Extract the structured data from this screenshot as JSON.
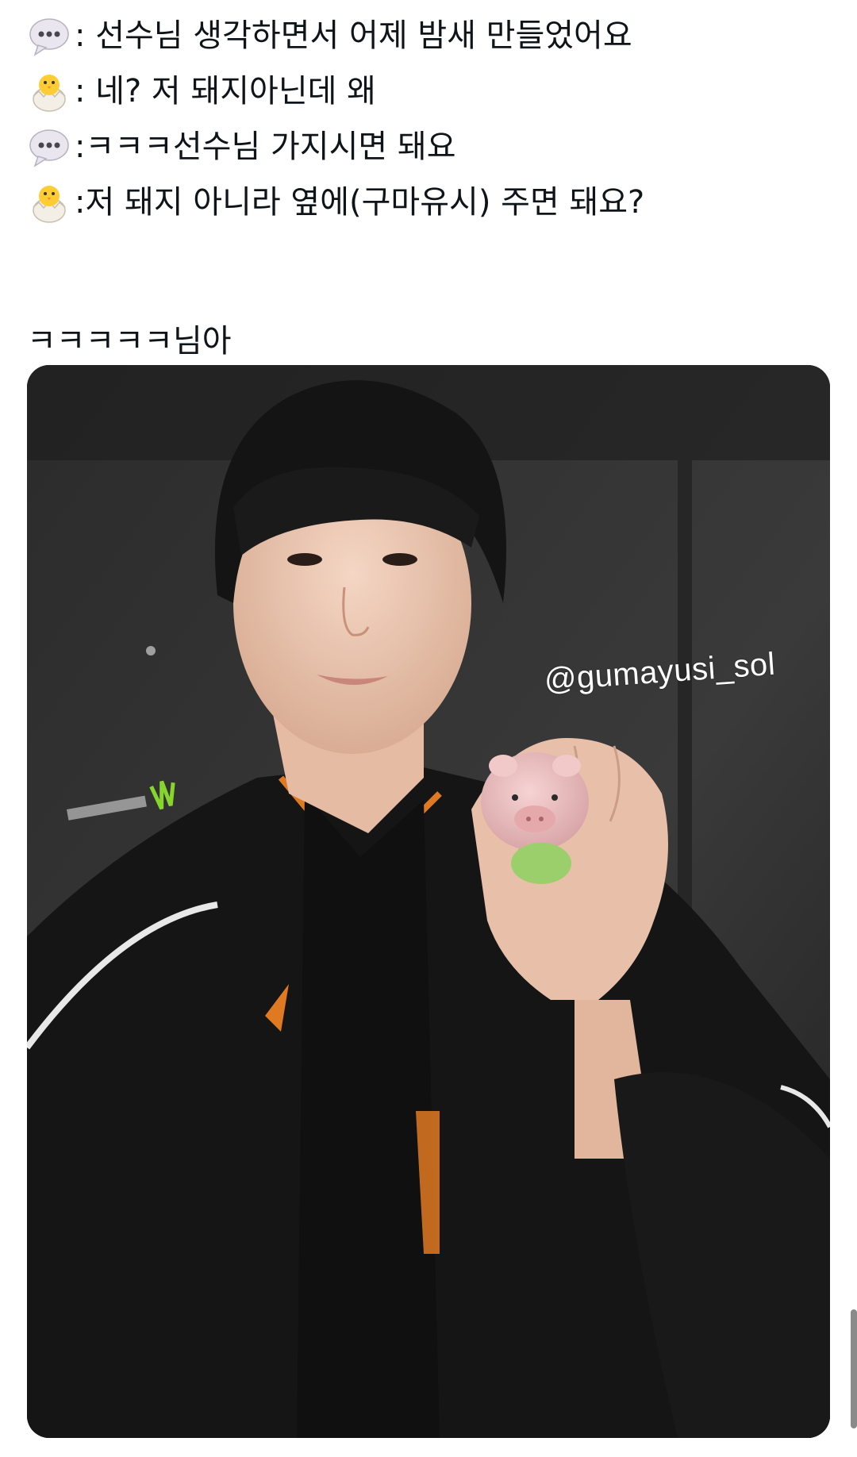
{
  "post": {
    "lines": [
      {
        "speaker_icon": "speech-balloon-icon",
        "text": ": 선수님 생각하면서 어제 밤새 만들었어요"
      },
      {
        "speaker_icon": "hatching-chick-icon",
        "text": ": 네? 저 돼지아닌데 왜"
      },
      {
        "speaker_icon": "speech-balloon-icon",
        "text": ":ㅋㅋㅋ선수님 가지시면 돼요"
      },
      {
        "speaker_icon": "hatching-chick-icon",
        "text": ":저 돼지 아니라 옆에(구마유시) 주면 돼요?"
      }
    ],
    "closing": "ㅋㅋㅋㅋㅋ님아"
  },
  "media": {
    "watermark": "@gumayusi_sol"
  },
  "colors": {
    "text": "#0f1419",
    "background": "#ffffff"
  }
}
